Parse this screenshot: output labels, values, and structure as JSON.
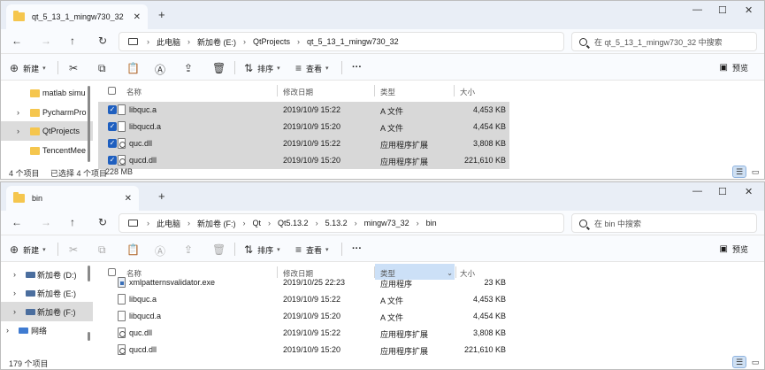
{
  "window1": {
    "tab_title": "qt_5_13_1_mingw730_32",
    "breadcrumb": [
      "此电脑",
      "新加卷 (E:)",
      "QtProjects",
      "qt_5_13_1_mingw730_32"
    ],
    "search_placeholder": "在 qt_5_13_1_mingw730_32 中搜索",
    "toolbar": {
      "new": "新建",
      "sort": "排序",
      "view": "查看",
      "more": "···",
      "preview": "预览"
    },
    "sidebar": [
      {
        "label": "matlab simu",
        "selected": false,
        "has_arrow": false
      },
      {
        "label": "PycharmPro",
        "selected": false,
        "has_arrow": true
      },
      {
        "label": "QtProjects",
        "selected": true,
        "has_arrow": true
      },
      {
        "label": "TencentMee",
        "selected": false,
        "has_arrow": false
      }
    ],
    "columns": {
      "name": "名称",
      "modified": "修改日期",
      "type": "类型",
      "size": "大小"
    },
    "files": [
      {
        "name": "libquc.a",
        "modified": "2019/10/9 15:22",
        "type": "A 文件",
        "size": "4,453 KB",
        "icon": "file",
        "selected": true
      },
      {
        "name": "libqucd.a",
        "modified": "2019/10/9 15:20",
        "type": "A 文件",
        "size": "4,454 KB",
        "icon": "file",
        "selected": true
      },
      {
        "name": "quc.dll",
        "modified": "2019/10/9 15:22",
        "type": "应用程序扩展",
        "size": "3,808 KB",
        "icon": "dll",
        "selected": true
      },
      {
        "name": "qucd.dll",
        "modified": "2019/10/9 15:20",
        "type": "应用程序扩展",
        "size": "221,610 KB",
        "icon": "dll",
        "selected": true
      }
    ],
    "status": {
      "count": "4 个项目",
      "selected": "已选择 4 个项目",
      "size": "228 MB"
    }
  },
  "window2": {
    "tab_title": "bin",
    "breadcrumb": [
      "此电脑",
      "新加卷 (F:)",
      "Qt",
      "Qt5.13.2",
      "5.13.2",
      "mingw73_32",
      "bin"
    ],
    "search_placeholder": "在 bin 中搜索",
    "toolbar": {
      "new": "新建",
      "sort": "排序",
      "view": "查看",
      "more": "···",
      "preview": "预览"
    },
    "sidebar": [
      {
        "label": "新加卷 (D:)",
        "selected": false,
        "icon": "drive"
      },
      {
        "label": "新加卷 (E:)",
        "selected": false,
        "icon": "drive"
      },
      {
        "label": "新加卷 (F:)",
        "selected": true,
        "icon": "drive"
      },
      {
        "label": "网络",
        "selected": false,
        "icon": "network"
      }
    ],
    "columns": {
      "name": "名称",
      "modified": "修改日期",
      "type": "类型",
      "size": "大小"
    },
    "files": [
      {
        "name": "xmlpatternsvalidator.exe",
        "modified": "2019/10/25 22:23",
        "type": "应用程序",
        "size": "23 KB",
        "icon": "exe",
        "selected": false
      },
      {
        "name": "libquc.a",
        "modified": "2019/10/9 15:22",
        "type": "A 文件",
        "size": "4,453 KB",
        "icon": "file",
        "selected": false
      },
      {
        "name": "libqucd.a",
        "modified": "2019/10/9 15:20",
        "type": "A 文件",
        "size": "4,454 KB",
        "icon": "file",
        "selected": false
      },
      {
        "name": "quc.dll",
        "modified": "2019/10/9 15:22",
        "type": "应用程序扩展",
        "size": "3,808 KB",
        "icon": "dll",
        "selected": false
      },
      {
        "name": "qucd.dll",
        "modified": "2019/10/9 15:20",
        "type": "应用程序扩展",
        "size": "221,610 KB",
        "icon": "dll",
        "selected": false
      }
    ],
    "status": {
      "count": "179 个项目"
    }
  },
  "colors": {
    "accent": "#1f5fbf",
    "selected_row": "#d8d8d8",
    "sort_header": "#cce0f7",
    "folder": "#f5c64e"
  }
}
